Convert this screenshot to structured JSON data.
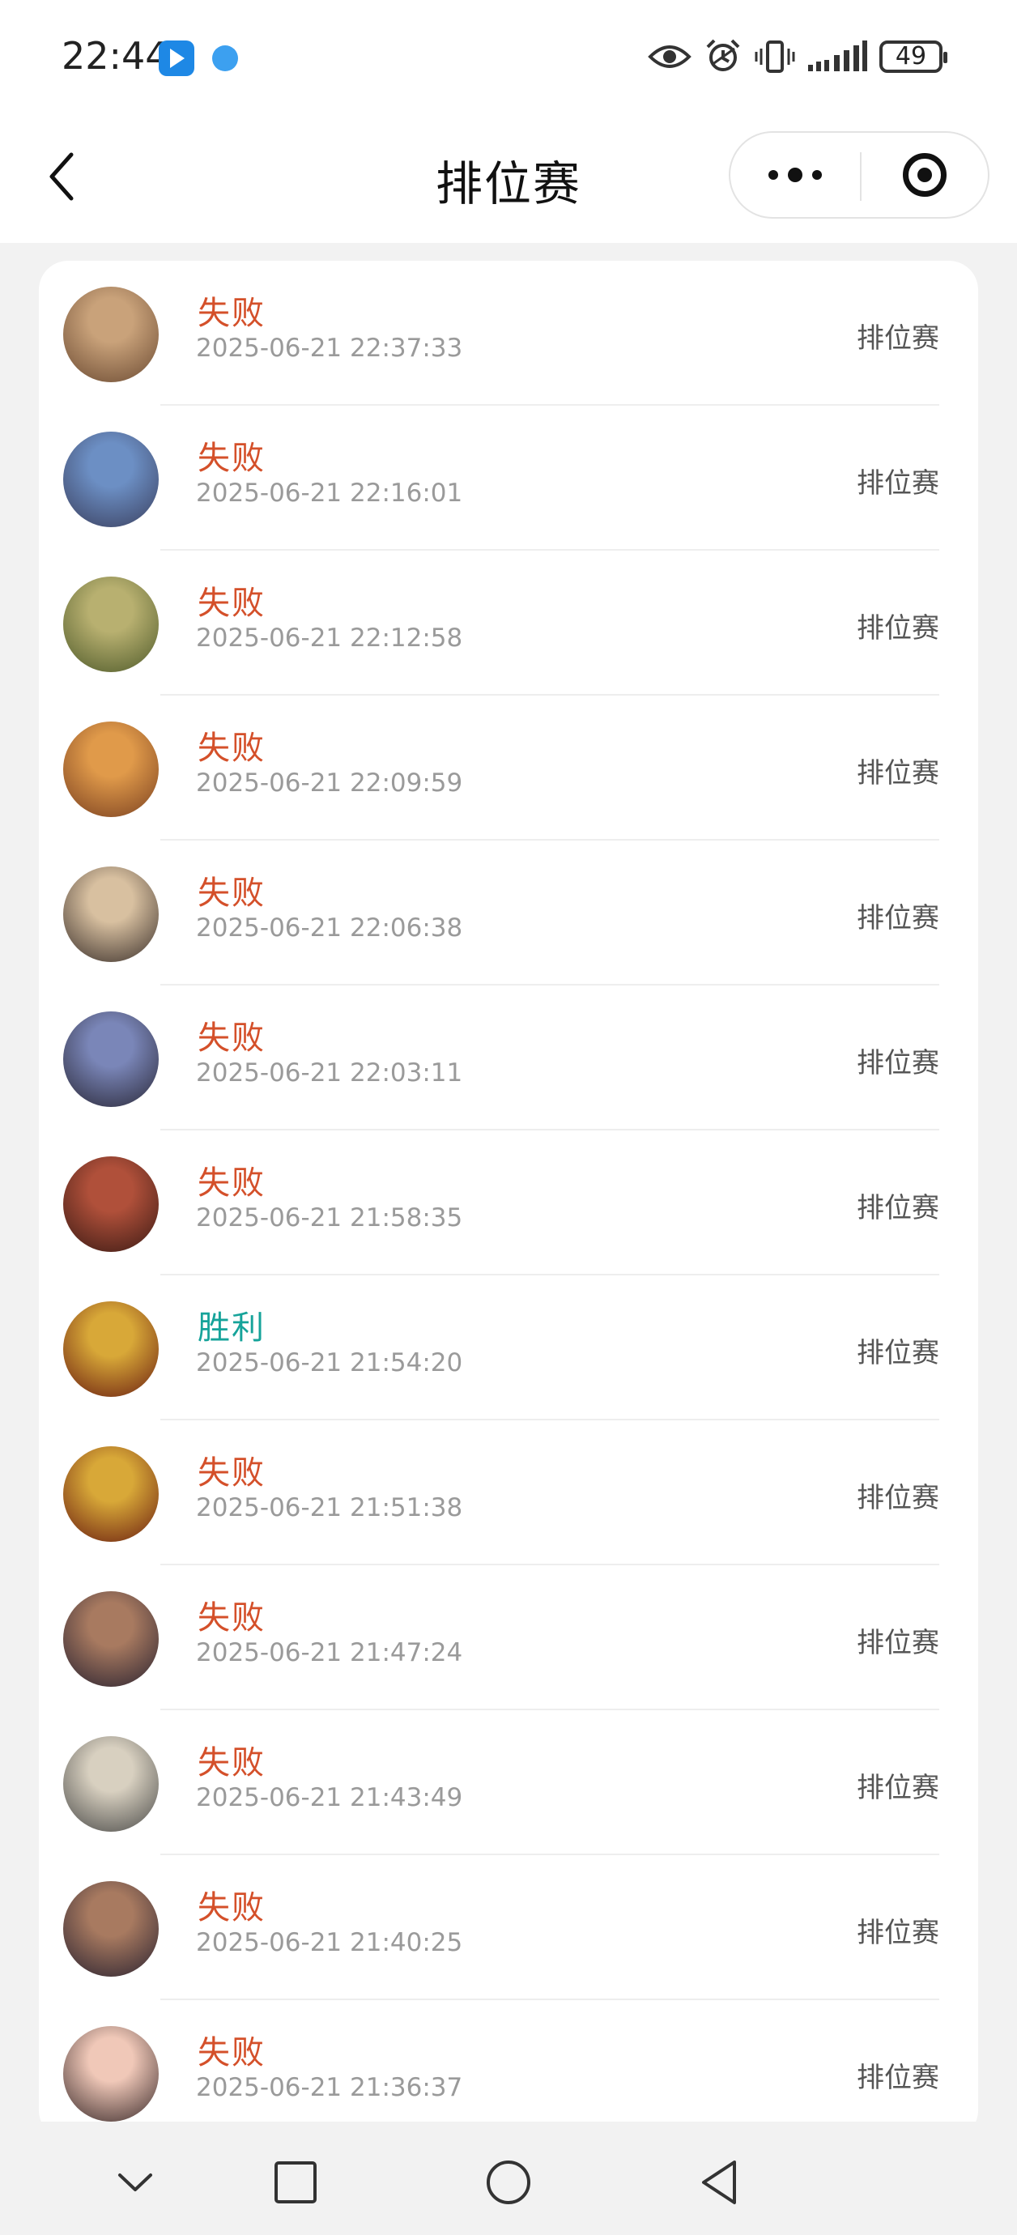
{
  "status_bar": {
    "time": "22:44",
    "battery": "49",
    "icons": [
      "blue-app-icon",
      "globe-app-icon",
      "eye-icon",
      "alarm-icon",
      "vibrate-icon",
      "signal-icon",
      "battery-icon"
    ]
  },
  "header": {
    "title": "排位赛"
  },
  "colors": {
    "loss": "#d4502a",
    "win": "#16a39a",
    "time": "#9a9a9a",
    "mode": "#555555"
  },
  "records": [
    {
      "result": "失败",
      "outcome": "loss",
      "time": "2025-06-21 22:37:33",
      "mode": "排位赛",
      "avatar_colors": [
        "#c9a27a",
        "#6b4a32"
      ]
    },
    {
      "result": "失败",
      "outcome": "loss",
      "time": "2025-06-21 22:16:01",
      "mode": "排位赛",
      "avatar_colors": [
        "#6c8fc4",
        "#3a3f5e"
      ]
    },
    {
      "result": "失败",
      "outcome": "loss",
      "time": "2025-06-21 22:12:58",
      "mode": "排位赛",
      "avatar_colors": [
        "#b8b070",
        "#4e5a2a"
      ]
    },
    {
      "result": "失败",
      "outcome": "loss",
      "time": "2025-06-21 22:09:59",
      "mode": "排位赛",
      "avatar_colors": [
        "#e09a4a",
        "#7a4020"
      ]
    },
    {
      "result": "失败",
      "outcome": "loss",
      "time": "2025-06-21 22:06:38",
      "mode": "排位赛",
      "avatar_colors": [
        "#d8c0a0",
        "#3a2f2a"
      ]
    },
    {
      "result": "失败",
      "outcome": "loss",
      "time": "2025-06-21 22:03:11",
      "mode": "排位赛",
      "avatar_colors": [
        "#7a86b8",
        "#2a2838"
      ]
    },
    {
      "result": "失败",
      "outcome": "loss",
      "time": "2025-06-21 21:58:35",
      "mode": "排位赛",
      "avatar_colors": [
        "#b0503a",
        "#3a1a14"
      ]
    },
    {
      "result": "胜利",
      "outcome": "win",
      "time": "2025-06-21 21:54:20",
      "mode": "排位赛",
      "avatar_colors": [
        "#d8a838",
        "#6a1e10"
      ]
    },
    {
      "result": "失败",
      "outcome": "loss",
      "time": "2025-06-21 21:51:38",
      "mode": "排位赛",
      "avatar_colors": [
        "#d8a838",
        "#6a1e10"
      ]
    },
    {
      "result": "失败",
      "outcome": "loss",
      "time": "2025-06-21 21:47:24",
      "mode": "排位赛",
      "avatar_colors": [
        "#a87a60",
        "#2a2230"
      ]
    },
    {
      "result": "失败",
      "outcome": "loss",
      "time": "2025-06-21 21:43:49",
      "mode": "排位赛",
      "avatar_colors": [
        "#d8d0c0",
        "#4a4a48"
      ]
    },
    {
      "result": "失败",
      "outcome": "loss",
      "time": "2025-06-21 21:40:25",
      "mode": "排位赛",
      "avatar_colors": [
        "#a87a60",
        "#2a2230"
      ]
    },
    {
      "result": "失败",
      "outcome": "loss",
      "time": "2025-06-21 21:36:37",
      "mode": "排位赛",
      "avatar_colors": [
        "#f0c8b8",
        "#3a2a2a"
      ]
    }
  ],
  "nav_bar": {
    "icons": [
      "chevron-down-icon",
      "square-icon",
      "circle-icon",
      "triangle-back-icon"
    ]
  }
}
